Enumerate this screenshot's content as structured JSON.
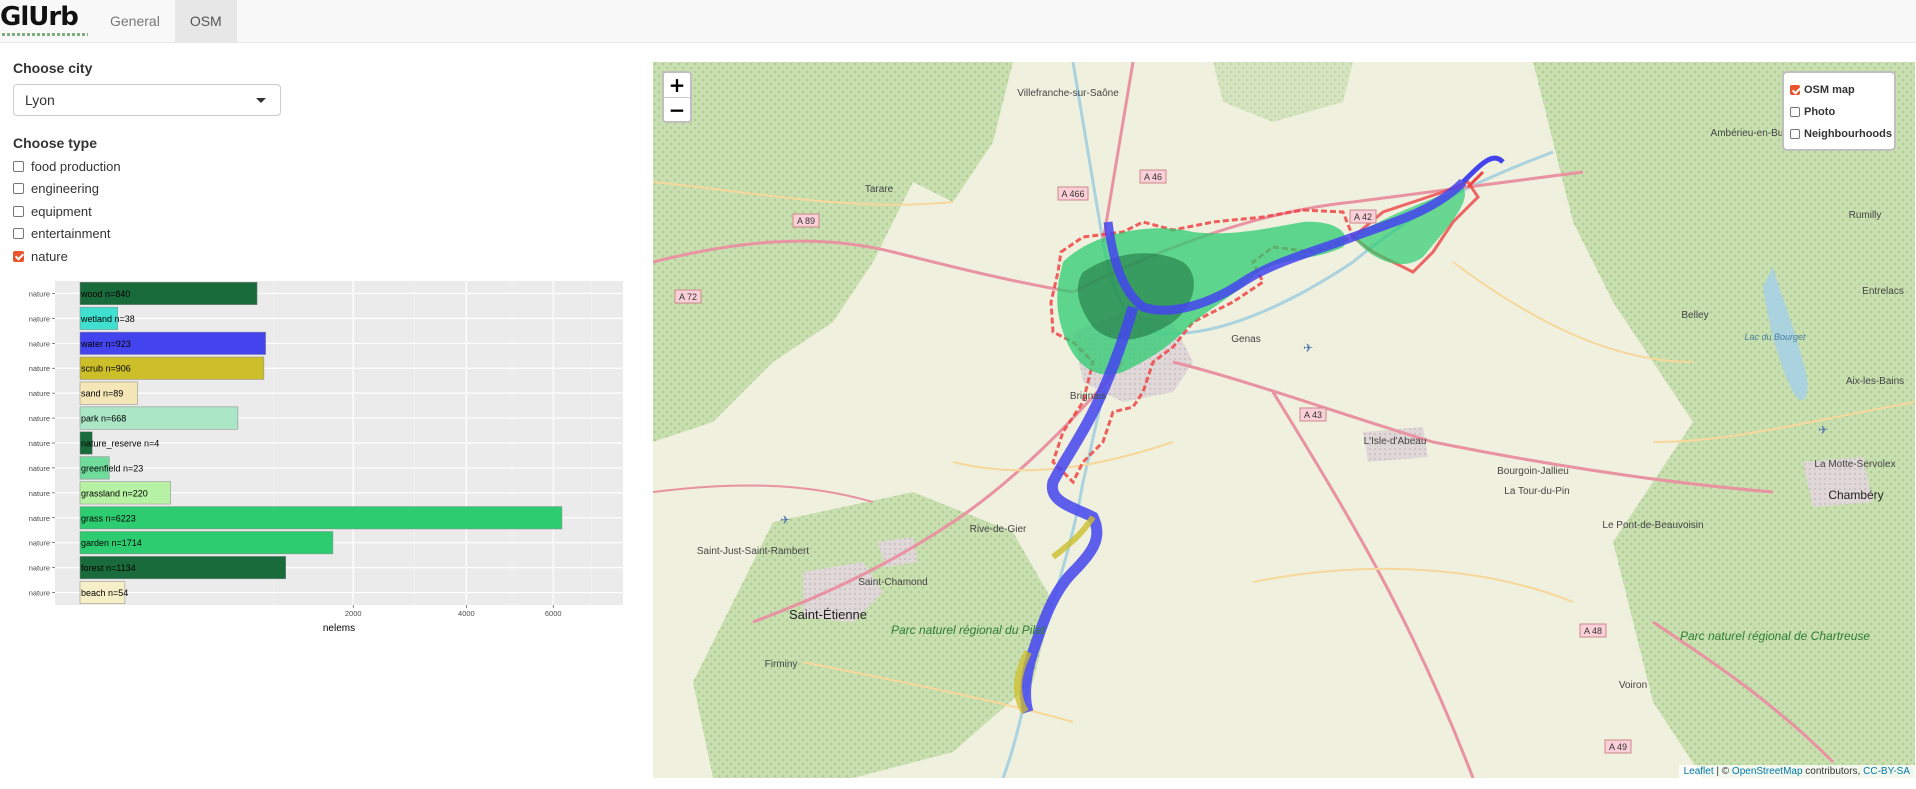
{
  "app": {
    "brand": "GlUrb",
    "tabs": [
      "General",
      "OSM"
    ],
    "active_tab": "OSM"
  },
  "sidebar": {
    "city_label": "Choose city",
    "city_value": "Lyon",
    "type_label": "Choose type",
    "types": [
      {
        "label": "food production",
        "checked": false
      },
      {
        "label": "engineering",
        "checked": false
      },
      {
        "label": "equipment",
        "checked": false
      },
      {
        "label": "entertainment",
        "checked": false
      },
      {
        "label": "nature",
        "checked": true
      }
    ]
  },
  "chart_data": {
    "type": "bar",
    "orientation": "horizontal",
    "title": "",
    "xlabel": "nelems",
    "ylabel": "",
    "x_scale": "sqrt",
    "x_ticks": [
      2000,
      4000,
      6000
    ],
    "y_tick_label": "nature",
    "categories": [
      "wood",
      "wetland",
      "water",
      "scrub",
      "sand",
      "park",
      "nature_reserve",
      "greenfield",
      "grassland",
      "grass",
      "garden",
      "forest",
      "beach"
    ],
    "values": [
      840,
      38,
      923,
      906,
      89,
      668,
      4,
      23,
      220,
      6223,
      1714,
      1134,
      54
    ],
    "bar_labels": [
      "wood n=840",
      "wetland n=38",
      "water n=923",
      "scrub n=906",
      "sand n=89",
      "park n=668",
      "nature_reserve n=4",
      "greenfield n=23",
      "grassland n=220",
      "grass n=6223",
      "garden n=1714",
      "forest n=1134",
      "beach n=54"
    ],
    "colors": [
      "#1a6b3c",
      "#3fe0d0",
      "#4444ee",
      "#cdbf2a",
      "#f5e6b8",
      "#abe6c6",
      "#1a6b3c",
      "#6fdc9c",
      "#b7f2a4",
      "#2ecc71",
      "#2ecc71",
      "#1a6b3c",
      "#f7efc8"
    ],
    "grid": true,
    "panel_background": "#ebebeb"
  },
  "map": {
    "zoom_in": "+",
    "zoom_out": "−",
    "layers": [
      {
        "label": "OSM map",
        "checked": true
      },
      {
        "label": "Photo",
        "checked": false
      },
      {
        "label": "Neighbourhoods",
        "checked": false
      }
    ],
    "attribution": {
      "leaflet": "Leaflet",
      "sep": " | © ",
      "osm": "OpenStreetMap",
      "contrib": " contributors, ",
      "license": "CC-BY-SA"
    },
    "place_labels": [
      {
        "text": "Villefranche-sur-Saône",
        "kind": "town"
      },
      {
        "text": "Tarare",
        "kind": "town"
      },
      {
        "text": "Ambérieu-en-Bugey",
        "kind": "town"
      },
      {
        "text": "Rumilly",
        "kind": "town"
      },
      {
        "text": "Belley",
        "kind": "town"
      },
      {
        "text": "Entrelacs",
        "kind": "town"
      },
      {
        "text": "Aix-les-Bains",
        "kind": "town"
      },
      {
        "text": "Genas",
        "kind": "town"
      },
      {
        "text": "Brignais",
        "kind": "town"
      },
      {
        "text": "L'Isle-d'Abeau",
        "kind": "town"
      },
      {
        "text": "Bourgoin-Jallieu",
        "kind": "town"
      },
      {
        "text": "La Tour-du-Pin",
        "kind": "town"
      },
      {
        "text": "La Motte-Servolex",
        "kind": "town"
      },
      {
        "text": "Chambéry",
        "kind": "city"
      },
      {
        "text": "Rive-de-Gier",
        "kind": "town"
      },
      {
        "text": "Saint-Just-Saint-Rambert",
        "kind": "town"
      },
      {
        "text": "Saint-Chamond",
        "kind": "town"
      },
      {
        "text": "Saint-Étienne",
        "kind": "city"
      },
      {
        "text": "Firminy",
        "kind": "town"
      },
      {
        "text": "Le Pont-de-Beauvoisin",
        "kind": "town"
      },
      {
        "text": "Voiron",
        "kind": "town"
      },
      {
        "text": "Parc naturel régional du Pilat",
        "kind": "park"
      },
      {
        "text": "Parc naturel régional de Chartreuse",
        "kind": "park"
      },
      {
        "text": "Lac du Bourget",
        "kind": "water"
      }
    ],
    "road_labels": [
      "A 466",
      "A 46",
      "A 89",
      "A 42",
      "A 72",
      "A 43",
      "A 48",
      "A 49"
    ]
  }
}
